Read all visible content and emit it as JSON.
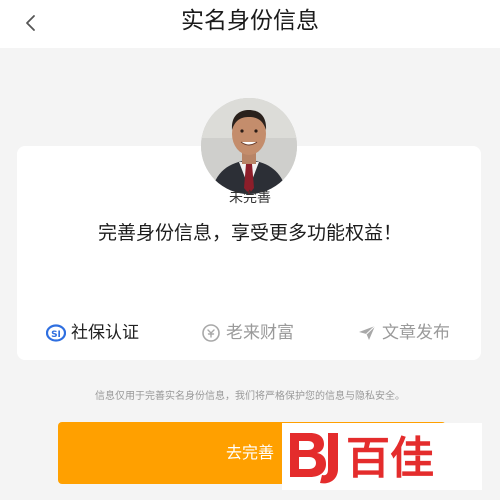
{
  "header": {
    "back_icon": "chevron-left-icon",
    "title": "实名身份信息"
  },
  "profile": {
    "status": "未完善",
    "headline": "完善身份信息，享受更多功能权益！"
  },
  "features": [
    {
      "label": "社保认证",
      "icon": "shebao-badge-icon",
      "state": "active"
    },
    {
      "label": "老来财富",
      "icon": "coin-icon",
      "state": "inactive"
    },
    {
      "label": "文章发布",
      "icon": "paper-plane-icon",
      "state": "inactive"
    }
  ],
  "privacy_note": "信息仅用于完善实名身份信息，我们将严格保护您的信息与隐私安全。",
  "action": {
    "label": "去完善"
  },
  "watermark": {
    "text": "百佳"
  },
  "colors": {
    "accent": "#ffa000",
    "shebao_blue": "#2f6fe0",
    "watermark_red": "#e42c2c"
  }
}
